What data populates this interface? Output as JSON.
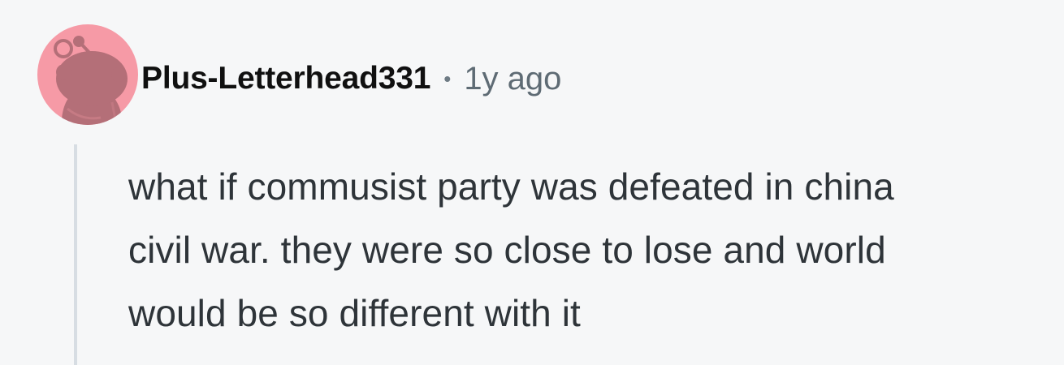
{
  "comment": {
    "author": "Plus-Letterhead331",
    "separator": "•",
    "timestamp": "1y ago",
    "body_lines": [
      "what if commusist party was defeated in china",
      "civil war. they were so close to lose and world",
      "would be so different with it"
    ]
  },
  "colors": {
    "background": "#f6f7f8",
    "avatar_background": "#f69aa6",
    "avatar_figure": "#b46f78",
    "thread_line": "#d7dde3",
    "username": "#101010",
    "timestamp": "#5e6b74",
    "body_text": "#2e3439"
  },
  "icons": {
    "avatar": "reddit-snoo-avatar-icon"
  }
}
